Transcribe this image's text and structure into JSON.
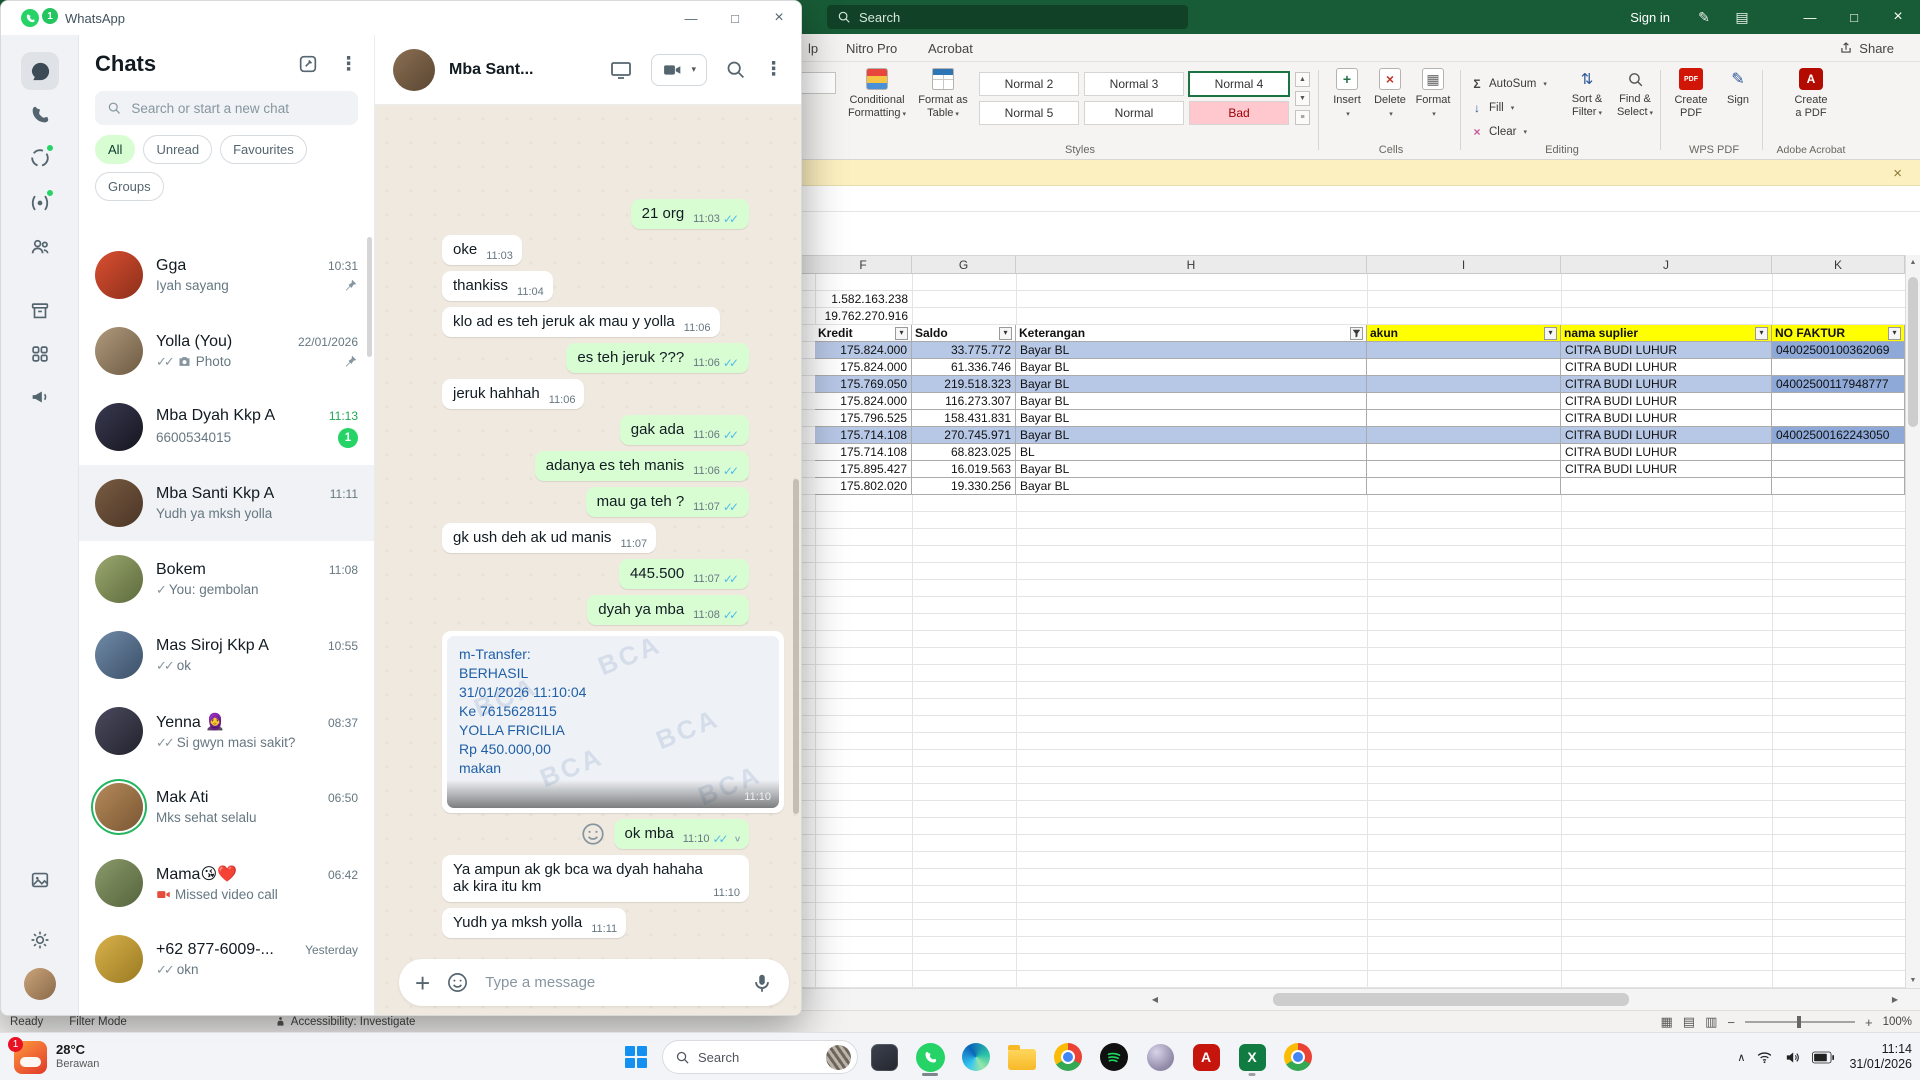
{
  "colors": {
    "whatsapp_green": "#25d366",
    "outgoing_bubble": "#d9fdd3",
    "chat_background": "#efe9df",
    "excel_titlebar_green": "#185c37",
    "row_highlight_blue": "#b7c7e6",
    "faktur_cell_blue": "#8ea9d8",
    "header_yellow": "#ffff00",
    "bad_style_bg": "#ffc7ce",
    "bad_style_text": "#9c0006"
  },
  "icons": {
    "close": "×",
    "minimize": "—",
    "maximize": "□",
    "menu_dots": "⋮",
    "chevron_down": "▾",
    "plus": "+",
    "tray_chevron": "∧",
    "scroll_up": "▲",
    "scroll_down": "▼",
    "scroll_left": "◀",
    "scroll_right": "▶",
    "gallery_more": "≡",
    "sigma": "Σ",
    "down_arrow": "↓",
    "clear_cross": "×",
    "grid": "▦",
    "view_normal": "▦",
    "view_layout": "▤",
    "view_break": "▥",
    "sort_arrows": "⇅",
    "pencil": "✎",
    "panel": "▤",
    "pdf_label": "PDF",
    "acrobat_a": "A",
    "excel_x": "X",
    "zoom_minus": "−",
    "zoom_plus": "+"
  },
  "whatsapp": {
    "window_title": "WhatsApp",
    "unread_badge": "1",
    "chats_panel": {
      "title": "Chats",
      "search_placeholder": "Search or start a new chat",
      "filters": [
        {
          "label": "All",
          "active": true
        },
        {
          "label": "Unread",
          "active": false
        },
        {
          "label": "Favourites",
          "active": false
        },
        {
          "label": "Groups",
          "active": false
        }
      ],
      "chats": [
        {
          "name": "Gga",
          "time": "10:31",
          "preview": "Iyah sayang",
          "pinned": true,
          "avatar": "linear-gradient(135deg,#d94f30,#8c2f1b)"
        },
        {
          "name": "Yolla (You)",
          "time": "22/01/2026",
          "preview": "Photo",
          "ticks": "✓✓",
          "camera": true,
          "pinned": true,
          "avatar": "linear-gradient(135deg,#b09a7d,#6d5a42)"
        },
        {
          "name": "Mba Dyah Kkp A",
          "time": "11:13",
          "preview": "6600534015",
          "badge": "1",
          "avatar": "linear-gradient(135deg,#3a3a52,#15151f)"
        },
        {
          "name": "Mba Santi Kkp A",
          "time": "11:11",
          "preview": "Yudh ya mksh yolla",
          "selected": true,
          "avatar": "linear-gradient(135deg,#7a5c42,#4a3526)"
        },
        {
          "name": "Bokem",
          "time": "11:08",
          "preview": "You: gembolan",
          "ticks": "✓",
          "avatar": "linear-gradient(135deg,#9aa86f,#5d6a3c)"
        },
        {
          "name": "Mas Siroj Kkp A",
          "time": "10:55",
          "preview": "ok",
          "ticks": "✓✓",
          "avatar": "linear-gradient(135deg,#6f8aa8,#3c5068)"
        },
        {
          "name": "Yenna 🧕",
          "time": "08:37",
          "preview": "Si gwyn masi sakit?",
          "ticks": "✓✓",
          "avatar": "linear-gradient(135deg,#4a4a5e,#23232e)"
        },
        {
          "name": "Mak Ati",
          "time": "06:50",
          "preview": "Mks sehat selalu",
          "ring": true,
          "avatar": "linear-gradient(135deg,#b58a5a,#7a5632)"
        },
        {
          "name": "Mama😘❤️",
          "time": "06:42",
          "preview": "Missed video call",
          "missed": true,
          "avatar": "linear-gradient(135deg,#8a9a6a,#55643c)"
        },
        {
          "name": "+62 877-6009-...",
          "time": "Yesterday",
          "preview": "okn",
          "ticks": "✓✓",
          "avatar": "linear-gradient(135deg,#d8b14a,#9a7a22)"
        }
      ]
    },
    "conversation": {
      "contact_name": "Mba Sant...",
      "composer_placeholder": "Type a message",
      "messages": [
        {
          "dir": "out",
          "text": "21 org",
          "time": "11:03"
        },
        {
          "dir": "in",
          "text": "oke",
          "time": "11:03"
        },
        {
          "dir": "in",
          "text": "thankiss",
          "time": "11:04"
        },
        {
          "dir": "in",
          "text": "klo ad es teh jeruk ak mau y yolla",
          "time": "11:06"
        },
        {
          "dir": "out",
          "text": "es teh jeruk ???",
          "time": "11:06"
        },
        {
          "dir": "in",
          "text": "jeruk hahhah",
          "time": "11:06"
        },
        {
          "dir": "out",
          "text": "gak ada",
          "time": "11:06"
        },
        {
          "dir": "out",
          "text": "adanya es teh manis",
          "time": "11:06"
        },
        {
          "dir": "out",
          "text": "mau ga teh ?",
          "time": "11:07"
        },
        {
          "dir": "in",
          "text": "gk ush deh ak ud manis",
          "time": "11:07"
        },
        {
          "dir": "out",
          "text": "445.500",
          "time": "11:07"
        },
        {
          "dir": "out",
          "text": "dyah ya mba",
          "time": "11:08"
        },
        {
          "dir": "in",
          "type": "image",
          "time": "11:10",
          "watermark": "BCA",
          "image_lines": [
            "m-Transfer:",
            "BERHASIL",
            "31/01/2026 11:10:04",
            "Ke 7615628115",
            "YOLLA FRICILIA",
            "Rp 450.000,00",
            "makan"
          ]
        },
        {
          "dir": "out",
          "text": "ok mba",
          "time": "11:10",
          "reaction_hover": true
        },
        {
          "dir": "in",
          "text": "Ya ampun ak gk bca wa dyah hahaha ak kira itu km",
          "time": "11:10"
        },
        {
          "dir": "in",
          "text": "Yudh ya mksh yolla",
          "time": "11:11"
        }
      ]
    }
  },
  "excel": {
    "search_placeholder": "Search",
    "sign_in": "Sign in",
    "tabs": [
      "lp",
      "Nitro Pro",
      "Acrobat"
    ],
    "share_label": "Share",
    "ribbon": {
      "conditional_formatting": [
        "Conditional",
        "Formatting"
      ],
      "format_as_table": [
        "Format as",
        "Table"
      ],
      "styles": [
        "Normal 2",
        "Normal 3",
        "Normal 4",
        "Normal 5",
        "Normal",
        "Bad"
      ],
      "selected_style": "Normal 4",
      "styles_group": "Styles",
      "cells_buttons": [
        "Insert",
        "Delete",
        "Format"
      ],
      "cells_group": "Cells",
      "autosum": "AutoSum",
      "fill": "Fill",
      "clear": "Clear",
      "sort_filter": [
        "Sort &",
        "Filter"
      ],
      "find_select": [
        "Find &",
        "Select"
      ],
      "editing_group": "Editing",
      "create_pdf": [
        "Create",
        "PDF"
      ],
      "sign": "Sign",
      "wps_group": "WPS PDF",
      "create_a_pdf": [
        "Create",
        "a PDF"
      ],
      "acrobat_group": "Adobe Acrobat"
    },
    "columns": [
      "F",
      "G",
      "H",
      "I",
      "J",
      "K"
    ],
    "pre_rows": [
      "1.582.163.238",
      "19.762.270.916"
    ],
    "table_headers": [
      "Kredit",
      "Saldo",
      "Keterangan",
      "akun",
      "nama suplier",
      "NO FAKTUR"
    ],
    "rows": [
      [
        "175.824.000",
        "33.775.772",
        "Bayar BL",
        "",
        "CITRA BUDI LUHUR",
        "04002500100362069"
      ],
      [
        "175.824.000",
        "61.336.746",
        "Bayar BL",
        "",
        "CITRA BUDI LUHUR",
        ""
      ],
      [
        "175.769.050",
        "219.518.323",
        "Bayar BL",
        "",
        "CITRA BUDI LUHUR",
        "04002500117948777"
      ],
      [
        "175.824.000",
        "116.273.307",
        "Bayar BL",
        "",
        "CITRA BUDI LUHUR",
        ""
      ],
      [
        "175.796.525",
        "158.431.831",
        "Bayar BL",
        "",
        "CITRA BUDI LUHUR",
        ""
      ],
      [
        "175.714.108",
        "270.745.971",
        "Bayar BL",
        "",
        "CITRA BUDI LUHUR",
        "04002500162243050"
      ],
      [
        "175.714.108",
        "68.823.025",
        "BL",
        "",
        "CITRA BUDI LUHUR",
        ""
      ],
      [
        "175.895.427",
        "16.019.563",
        "Bayar BL",
        "",
        "CITRA BUDI LUHUR",
        ""
      ],
      [
        "175.802.020",
        "19.330.256",
        "Bayar BL",
        "",
        "",
        ""
      ]
    ],
    "highlighted_rows": [
      0,
      2,
      5
    ],
    "status": {
      "ready": "Ready",
      "filter_mode": "Filter Mode",
      "accessibility": "Accessibility: Investigate",
      "zoom": "100%"
    }
  },
  "taskbar": {
    "weather": {
      "badge": "1",
      "temp": "28°C",
      "desc": "Berawan"
    },
    "search_label": "Search",
    "clock": {
      "time": "11:14",
      "date": "31/01/2026"
    }
  }
}
